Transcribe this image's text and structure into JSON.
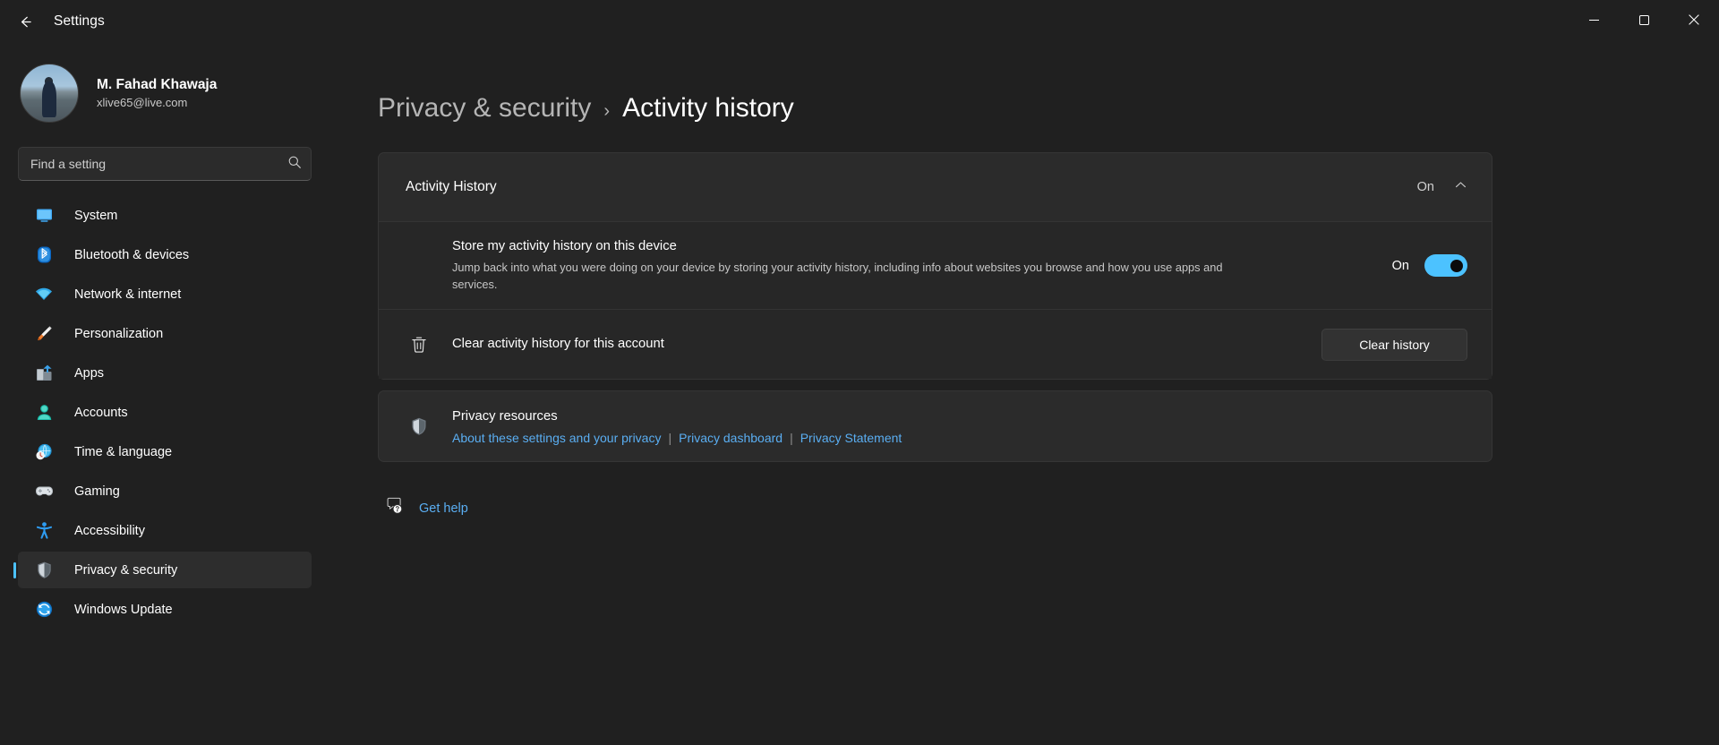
{
  "window": {
    "title": "Settings",
    "back_icon": "arrow-left-icon",
    "minimize_label": "Minimize",
    "maximize_label": "Maximize",
    "close_label": "Close"
  },
  "account": {
    "name": "M. Fahad Khawaja",
    "email": "xlive65@live.com",
    "avatar_alt": "User profile picture"
  },
  "search": {
    "placeholder": "Find a setting",
    "value": "",
    "icon": "search-icon"
  },
  "sidebar": {
    "items": [
      {
        "label": "System",
        "icon": "system-icon",
        "selected": false
      },
      {
        "label": "Bluetooth & devices",
        "icon": "bluetooth-icon",
        "selected": false
      },
      {
        "label": "Network & internet",
        "icon": "network-icon",
        "selected": false
      },
      {
        "label": "Personalization",
        "icon": "personalization-icon",
        "selected": false
      },
      {
        "label": "Apps",
        "icon": "apps-icon",
        "selected": false
      },
      {
        "label": "Accounts",
        "icon": "accounts-icon",
        "selected": false
      },
      {
        "label": "Time & language",
        "icon": "time-language-icon",
        "selected": false
      },
      {
        "label": "Gaming",
        "icon": "gaming-icon",
        "selected": false
      },
      {
        "label": "Accessibility",
        "icon": "accessibility-icon",
        "selected": false
      },
      {
        "label": "Privacy & security",
        "icon": "shield-icon",
        "selected": true
      },
      {
        "label": "Windows Update",
        "icon": "windows-update-icon",
        "selected": false
      }
    ]
  },
  "breadcrumb": {
    "parent": "Privacy & security",
    "separator": "›",
    "current": "Activity history"
  },
  "activity_history_card": {
    "title": "Activity History",
    "state": "On",
    "chevron_icon": "chevron-up-icon",
    "expanded": true,
    "store_setting": {
      "title": "Store my activity history on this device",
      "description": "Jump back into what you were doing on your device by storing your activity history, including info about websites you browse and how you use apps and services.",
      "toggle_label": "On",
      "toggle_on": true
    },
    "clear_setting": {
      "icon": "trash-icon",
      "title": "Clear activity history for this account",
      "button_label": "Clear history"
    }
  },
  "privacy_resources": {
    "icon": "shield-icon",
    "title": "Privacy resources",
    "links": [
      "About these settings and your privacy",
      "Privacy dashboard",
      "Privacy Statement"
    ],
    "separator": "|"
  },
  "get_help": {
    "icon": "help-icon",
    "label": "Get help"
  },
  "colors": {
    "accent": "#4cc2ff",
    "link": "#5aaef2",
    "background": "#202020",
    "card": "#2b2b2b",
    "close_hover": "#c42b1c"
  }
}
